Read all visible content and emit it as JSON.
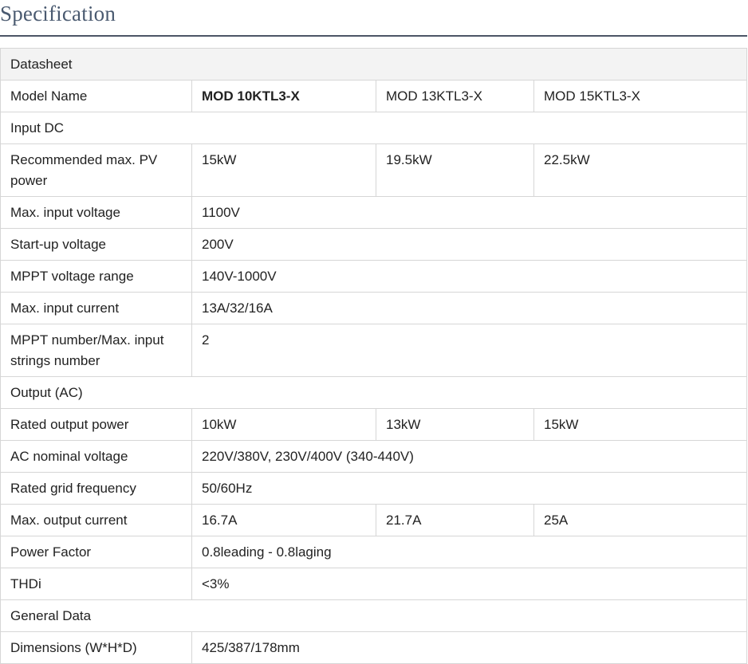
{
  "page": {
    "title": "Specification"
  },
  "table": {
    "datasheet_header": "Datasheet",
    "model_row": {
      "label": "Model Name",
      "models": [
        "MOD 10KTL3-X",
        "MOD 13KTL3-X",
        "MOD 15KTL3-X"
      ]
    },
    "input_section": "Input DC",
    "rec_pv": {
      "label": "Recommended max. PV power",
      "values": [
        "15kW",
        "19.5kW",
        "22.5kW"
      ]
    },
    "max_input_voltage": {
      "label": "Max. input voltage",
      "value": "1100V"
    },
    "startup_voltage": {
      "label": "Start-up voltage",
      "value": "200V"
    },
    "mppt_range": {
      "label": "MPPT voltage range",
      "value": "140V-1000V"
    },
    "max_input_current": {
      "label": "Max. input current",
      "value": "13A/32/16A"
    },
    "mppt_number": {
      "label": "MPPT number/Max. input strings number",
      "value": "2"
    },
    "output_section": "Output (AC)",
    "rated_output_power": {
      "label": "Rated output power",
      "values": [
        "10kW",
        "13kW",
        "15kW"
      ]
    },
    "ac_nominal_voltage": {
      "label": "AC nominal voltage",
      "value": "220V/380V, 230V/400V (340-440V)"
    },
    "rated_grid_freq": {
      "label": "Rated grid frequency",
      "value": "50/60Hz"
    },
    "max_output_current": {
      "label": "Max. output current",
      "values": [
        "16.7A",
        "21.7A",
        "25A"
      ]
    },
    "power_factor": {
      "label": "Power Factor",
      "value": "0.8leading - 0.8laging"
    },
    "thdi": {
      "label": "THDi",
      "value": "<3%"
    },
    "general_section": "General Data",
    "dimensions": {
      "label": "Dimensions (W*H*D)",
      "value": "425/387/178mm"
    }
  }
}
